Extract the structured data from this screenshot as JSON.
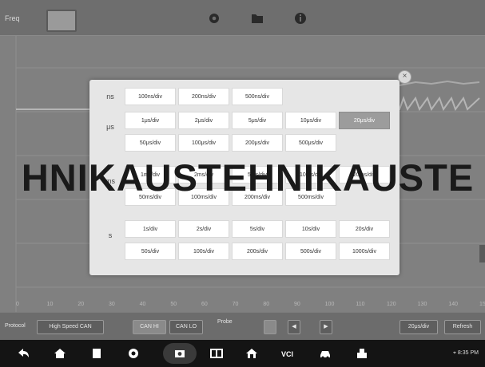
{
  "toolbar": {
    "title": "Freq",
    "icons": [
      "settings-icon",
      "folder-icon",
      "info-icon"
    ]
  },
  "scope": {
    "x_ticks": [
      "0",
      "10",
      "20",
      "30",
      "40",
      "50",
      "60",
      "70",
      "80",
      "90",
      "100",
      "110",
      "120",
      "130",
      "140",
      "150"
    ]
  },
  "modal": {
    "close_label": "×",
    "groups": [
      {
        "unit": "ns",
        "cells": [
          "100ns/div",
          "200ns/div",
          "500ns/div"
        ]
      },
      {
        "unit": "μs",
        "cells": [
          "1μs/div",
          "2μs/div",
          "5μs/div",
          "10μs/div",
          "20μs/div",
          "50μs/div",
          "100μs/div",
          "200μs/div",
          "500μs/div"
        ],
        "selected": "20μs/div"
      },
      {
        "unit": "ms",
        "cells": [
          "1ms/div",
          "2ms/div",
          "5ms/div",
          "10ms/div",
          "20ms/div",
          "50ms/div",
          "100ms/div",
          "200ms/div",
          "500ms/div"
        ]
      },
      {
        "unit": "s",
        "cells": [
          "1s/div",
          "2s/div",
          "5s/div",
          "10s/div",
          "20s/div",
          "50s/div",
          "100s/div",
          "200s/div",
          "500s/div",
          "1000s/div"
        ]
      }
    ]
  },
  "controls": {
    "protocol_label": "Protocol",
    "protocol_value": "High Speed CAN",
    "channel_a": "CAN HI",
    "channel_b": "CAN LO",
    "probe_label": "Probe",
    "time_value": "20μs/div",
    "refresh_label": "Refresh"
  },
  "navbar": {
    "status": "⌖ 8:35 PM"
  },
  "watermark": "HNIKAUSTEHNIKAUSTE"
}
